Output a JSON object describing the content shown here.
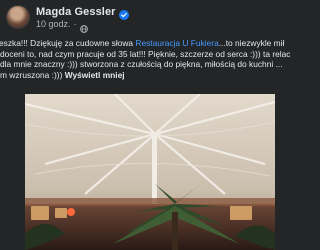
{
  "post": {
    "author": "Magda Gessler",
    "timestamp": "10 godz.",
    "separator": "·",
    "text_lines": {
      "l1_a": "eszka!!! Dziękuję za cudowne słowa ",
      "l1_mention": "Restauracja U Fukiera",
      "l1_b": "...to niezwykle mił",
      "l2": "doceni to, nad czym pracuje od 35 lat!!! Pięknie, szczerze od serca :))) ta relac",
      "l3": "dla mnie znaczny :))) stworzona z czułością do piękna, miłością do kuchni ...",
      "l4_a": "m wzruszona :))) ",
      "l4_link": "Wyświetl mniej"
    }
  },
  "colors": {
    "background": "#242526",
    "text": "#e4e6eb",
    "secondary_text": "#b0b3b8",
    "mention": "#4599ff",
    "verified": "#1877f2"
  },
  "icons": {
    "verified": "verified-badge-icon",
    "privacy": "globe-icon"
  }
}
